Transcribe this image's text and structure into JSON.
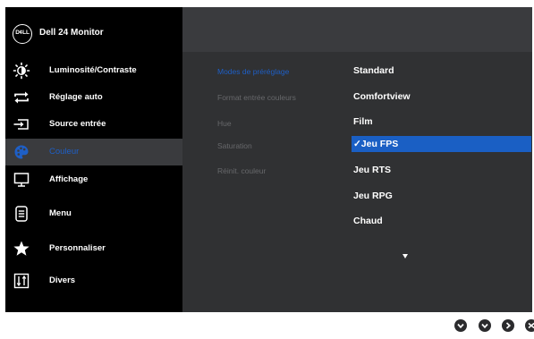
{
  "header": {
    "logo": "D¢LL",
    "title": "Dell 24 Monitor"
  },
  "menu": [
    {
      "label": "Luminosité/Contraste",
      "icon": "brightness-contrast-icon"
    },
    {
      "label": "Réglage auto",
      "icon": "auto-adjust-icon"
    },
    {
      "label": "Source entrée",
      "icon": "input-source-icon"
    },
    {
      "label": "Couleur",
      "icon": "color-palette-icon",
      "active": true
    },
    {
      "label": "Affichage",
      "icon": "display-monitor-icon"
    },
    {
      "label": "Menu",
      "icon": "menu-list-icon"
    },
    {
      "label": "Personnaliser",
      "icon": "star-icon"
    },
    {
      "label": "Divers",
      "icon": "others-sliders-icon"
    }
  ],
  "color_submenu": [
    {
      "label": "Modes de préréglage",
      "active": true
    },
    {
      "label": "Format entrée couleurs"
    },
    {
      "label": "Hue"
    },
    {
      "label": "Saturation"
    },
    {
      "label": "Réinit. couleur"
    }
  ],
  "preset_modes": [
    "Standard",
    "Comfortview",
    "Film",
    "✓Jeu FPS",
    "Jeu RTS",
    "Jeu RPG",
    "Chaud"
  ],
  "selected_preset": "Jeu FPS",
  "colors": {
    "sidebar_bg": "#000000",
    "panel_bg": "#303133",
    "highlight": "#1a5fc4",
    "active_text": "#1e5fc6",
    "dim_text": "#67686b"
  },
  "buttons": [
    "down-icon",
    "down-icon",
    "right-icon",
    "exit-icon"
  ]
}
